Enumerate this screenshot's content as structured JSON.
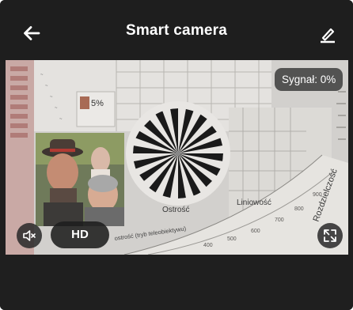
{
  "header": {
    "title": "Smart camera",
    "back_icon": "arrow-left-icon",
    "edit_icon": "pencil-icon"
  },
  "video": {
    "signal_text": "Sygnał: 0%",
    "quality_label": "HD",
    "mute_icon": "speaker-muted-icon",
    "fullscreen_icon": "fullscreen-icon",
    "scene": {
      "percent_label": "5%",
      "sharpness_label": "Ostrość",
      "linearity_label": "Liniowość",
      "resolution_label": "Rozdzielczość",
      "tele_label": "ostrość (tryb teleobiektywu)"
    }
  },
  "colors": {
    "bar_background": "#1e1e1e",
    "badge_background": "#373737",
    "text": "#ffffff"
  }
}
